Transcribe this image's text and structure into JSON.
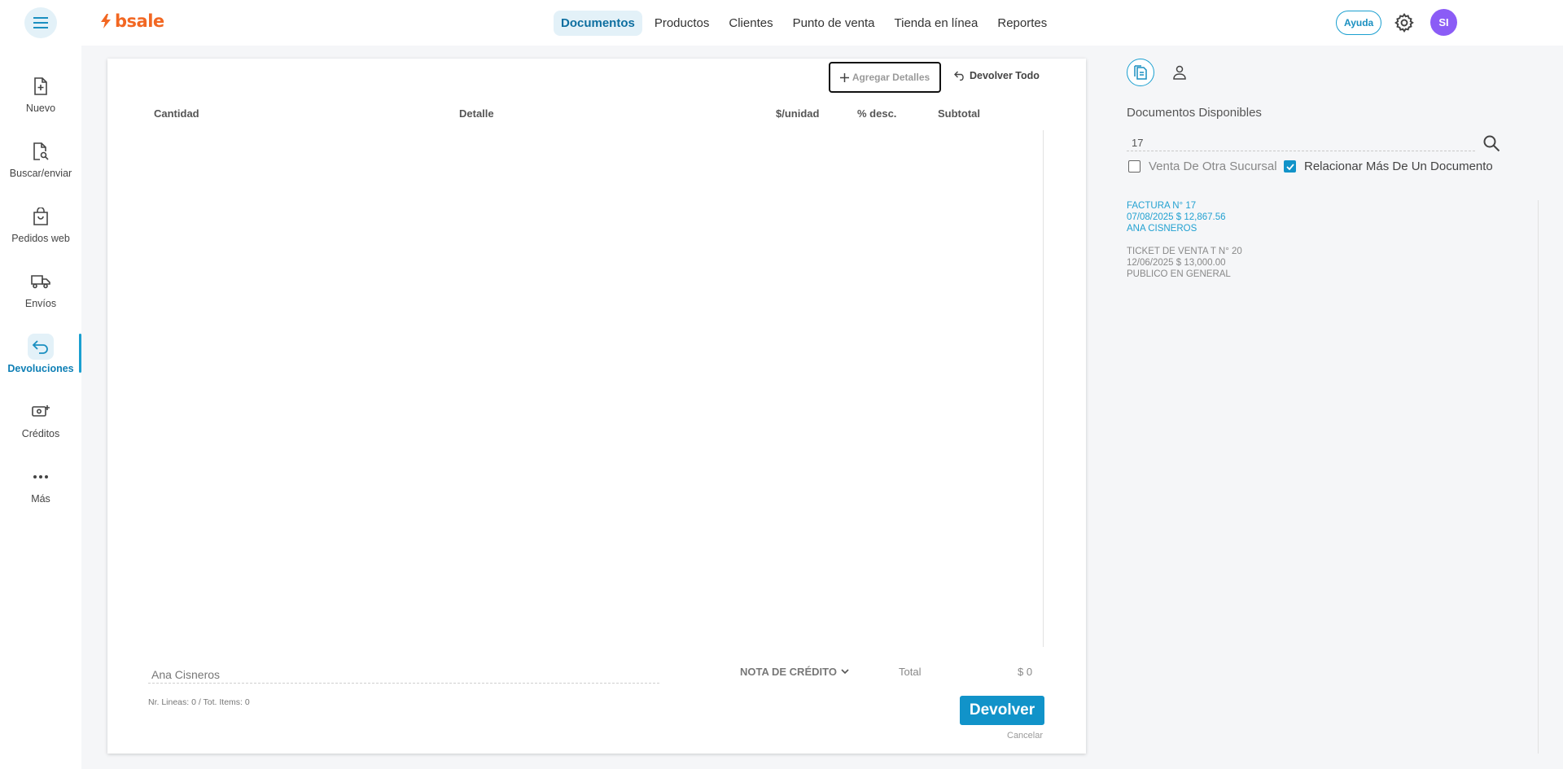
{
  "header": {
    "logo_text": "bsale",
    "nav": [
      {
        "label": "Documentos",
        "active": true
      },
      {
        "label": "Productos",
        "active": false
      },
      {
        "label": "Clientes",
        "active": false
      },
      {
        "label": "Punto de venta",
        "active": false
      },
      {
        "label": "Tienda en línea",
        "active": false
      },
      {
        "label": "Reportes",
        "active": false
      }
    ],
    "help_label": "Ayuda",
    "avatar_initials": "SI"
  },
  "sidebar": {
    "items": [
      {
        "label": "Nuevo",
        "icon": "file-plus-icon"
      },
      {
        "label": "Buscar/enviar",
        "icon": "file-search-icon"
      },
      {
        "label": "Pedidos web",
        "icon": "shopping-bag-icon"
      },
      {
        "label": "Envíos",
        "icon": "truck-icon"
      },
      {
        "label": "Devoluciones",
        "icon": "return-arrow-icon",
        "active": true
      },
      {
        "label": "Créditos",
        "icon": "money-plus-icon"
      },
      {
        "label": "Más",
        "icon": "more-dots-icon"
      }
    ]
  },
  "main": {
    "add_details_label": "Agregar Detalles",
    "return_all_label": "Devolver Todo",
    "columns": {
      "quantity": "Cantidad",
      "detail": "Detalle",
      "unit_price": "$/unidad",
      "discount": "% desc.",
      "subtotal": "Subtotal"
    },
    "client_name": "Ana Cisneros",
    "document_type": "NOTA DE CRÉDITO",
    "total_label": "Total",
    "total_value": "$ 0",
    "lines_info": "Nr. Lineas: 0 / Tot. Items: 0",
    "return_button": "Devolver",
    "cancel_label": "Cancelar"
  },
  "right_panel": {
    "title": "Documentos Disponibles",
    "search_value": "17",
    "checkboxes": [
      {
        "label": "Venta De Otra Sucursal",
        "checked": false
      },
      {
        "label": "Relacionar Más De Un Documento",
        "checked": true
      }
    ],
    "documents": [
      {
        "line1": "FACTURA N° 17",
        "line2": "07/08/2025 $ 12,867.56",
        "line3": "ANA CISNEROS",
        "highlight": true
      },
      {
        "line1": "TICKET DE VENTA T N° 20",
        "line2": "12/06/2025 $ 13,000.00",
        "line3": "PUBLICO EN GENERAL",
        "highlight": false
      }
    ]
  },
  "colors": {
    "brand_orange": "#f26722",
    "accent_blue": "#1193c9",
    "avatar_purple": "#8b5cf6"
  }
}
